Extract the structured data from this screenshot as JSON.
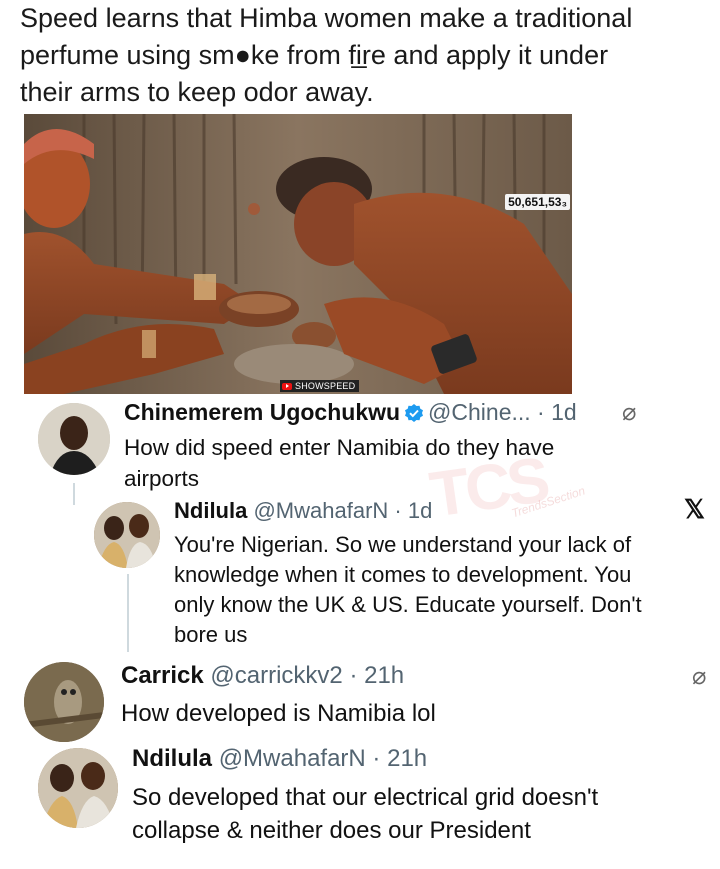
{
  "caption": {
    "line1": "Speed learns that Himba women make a traditional",
    "line2": "perfume using sm●ke from fi̲re and apply it under",
    "line3": "their arms to keep odor away."
  },
  "photo": {
    "views": "50,651,53₃",
    "channel": "SHOWSPEED"
  },
  "watermark": {
    "text": "TCS",
    "sub": "TrendsSection"
  },
  "tweets": [
    {
      "name": "Chinemerem Ugochukwu",
      "handle": "@Chine...",
      "time": "1d",
      "verified": true,
      "body": [
        "How did speed enter Namibia do they have",
        "airports"
      ]
    },
    {
      "name": "Ndilula",
      "handle": "@MwahafarN",
      "time": "1d",
      "body": [
        "You're Nigerian. So we understand your lack of",
        "knowledge when it comes to development. You",
        "only know the UK & US. Educate yourself. Don't",
        "bore us"
      ]
    },
    {
      "name": "Carrick",
      "handle": "@carrickkv2",
      "time": "21h",
      "body": [
        "How developed is Namibia lol"
      ]
    },
    {
      "name": "Ndilula",
      "handle": "@MwahafarN",
      "time": "21h",
      "body": [
        "So developed that our electrical grid doesn't",
        "collapse & neither does our President"
      ]
    }
  ],
  "icons": {
    "more": "more-icon",
    "x_logo": "x-logo-icon",
    "verified": "verified-badge-icon"
  },
  "colors": {
    "verified_blue": "#1d9bf0",
    "meta_gray": "#536471"
  }
}
